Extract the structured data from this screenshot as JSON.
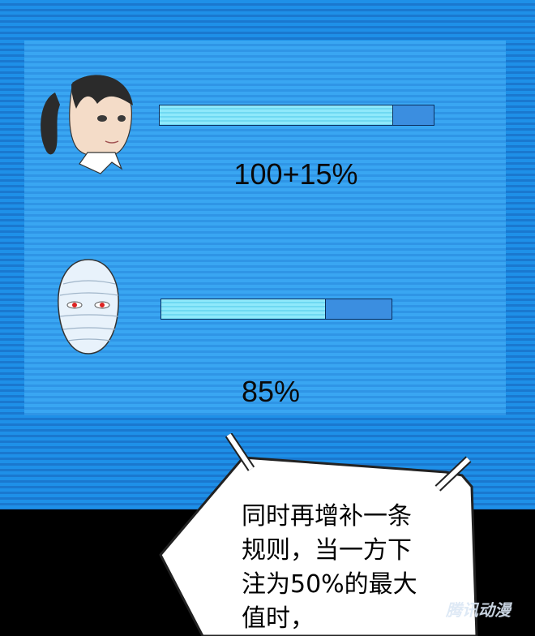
{
  "players": [
    {
      "name": "girl-player",
      "percent_label": "100+15%",
      "bar_fill_fraction": 0.85
    },
    {
      "name": "mask-player",
      "percent_label": "85%",
      "bar_fill_fraction": 0.71
    }
  ],
  "speech_bubble": {
    "lines": [
      "同时再增补一条",
      "规则，当一方下",
      "注为50%的最大",
      "值时，"
    ]
  },
  "watermark": "腾讯动漫",
  "colors": {
    "screen_blue": "#1e90e8",
    "panel_blue": "#39a6f2",
    "bar_fill": "#8fe9fb",
    "bar_empty": "#3b8ee0"
  }
}
